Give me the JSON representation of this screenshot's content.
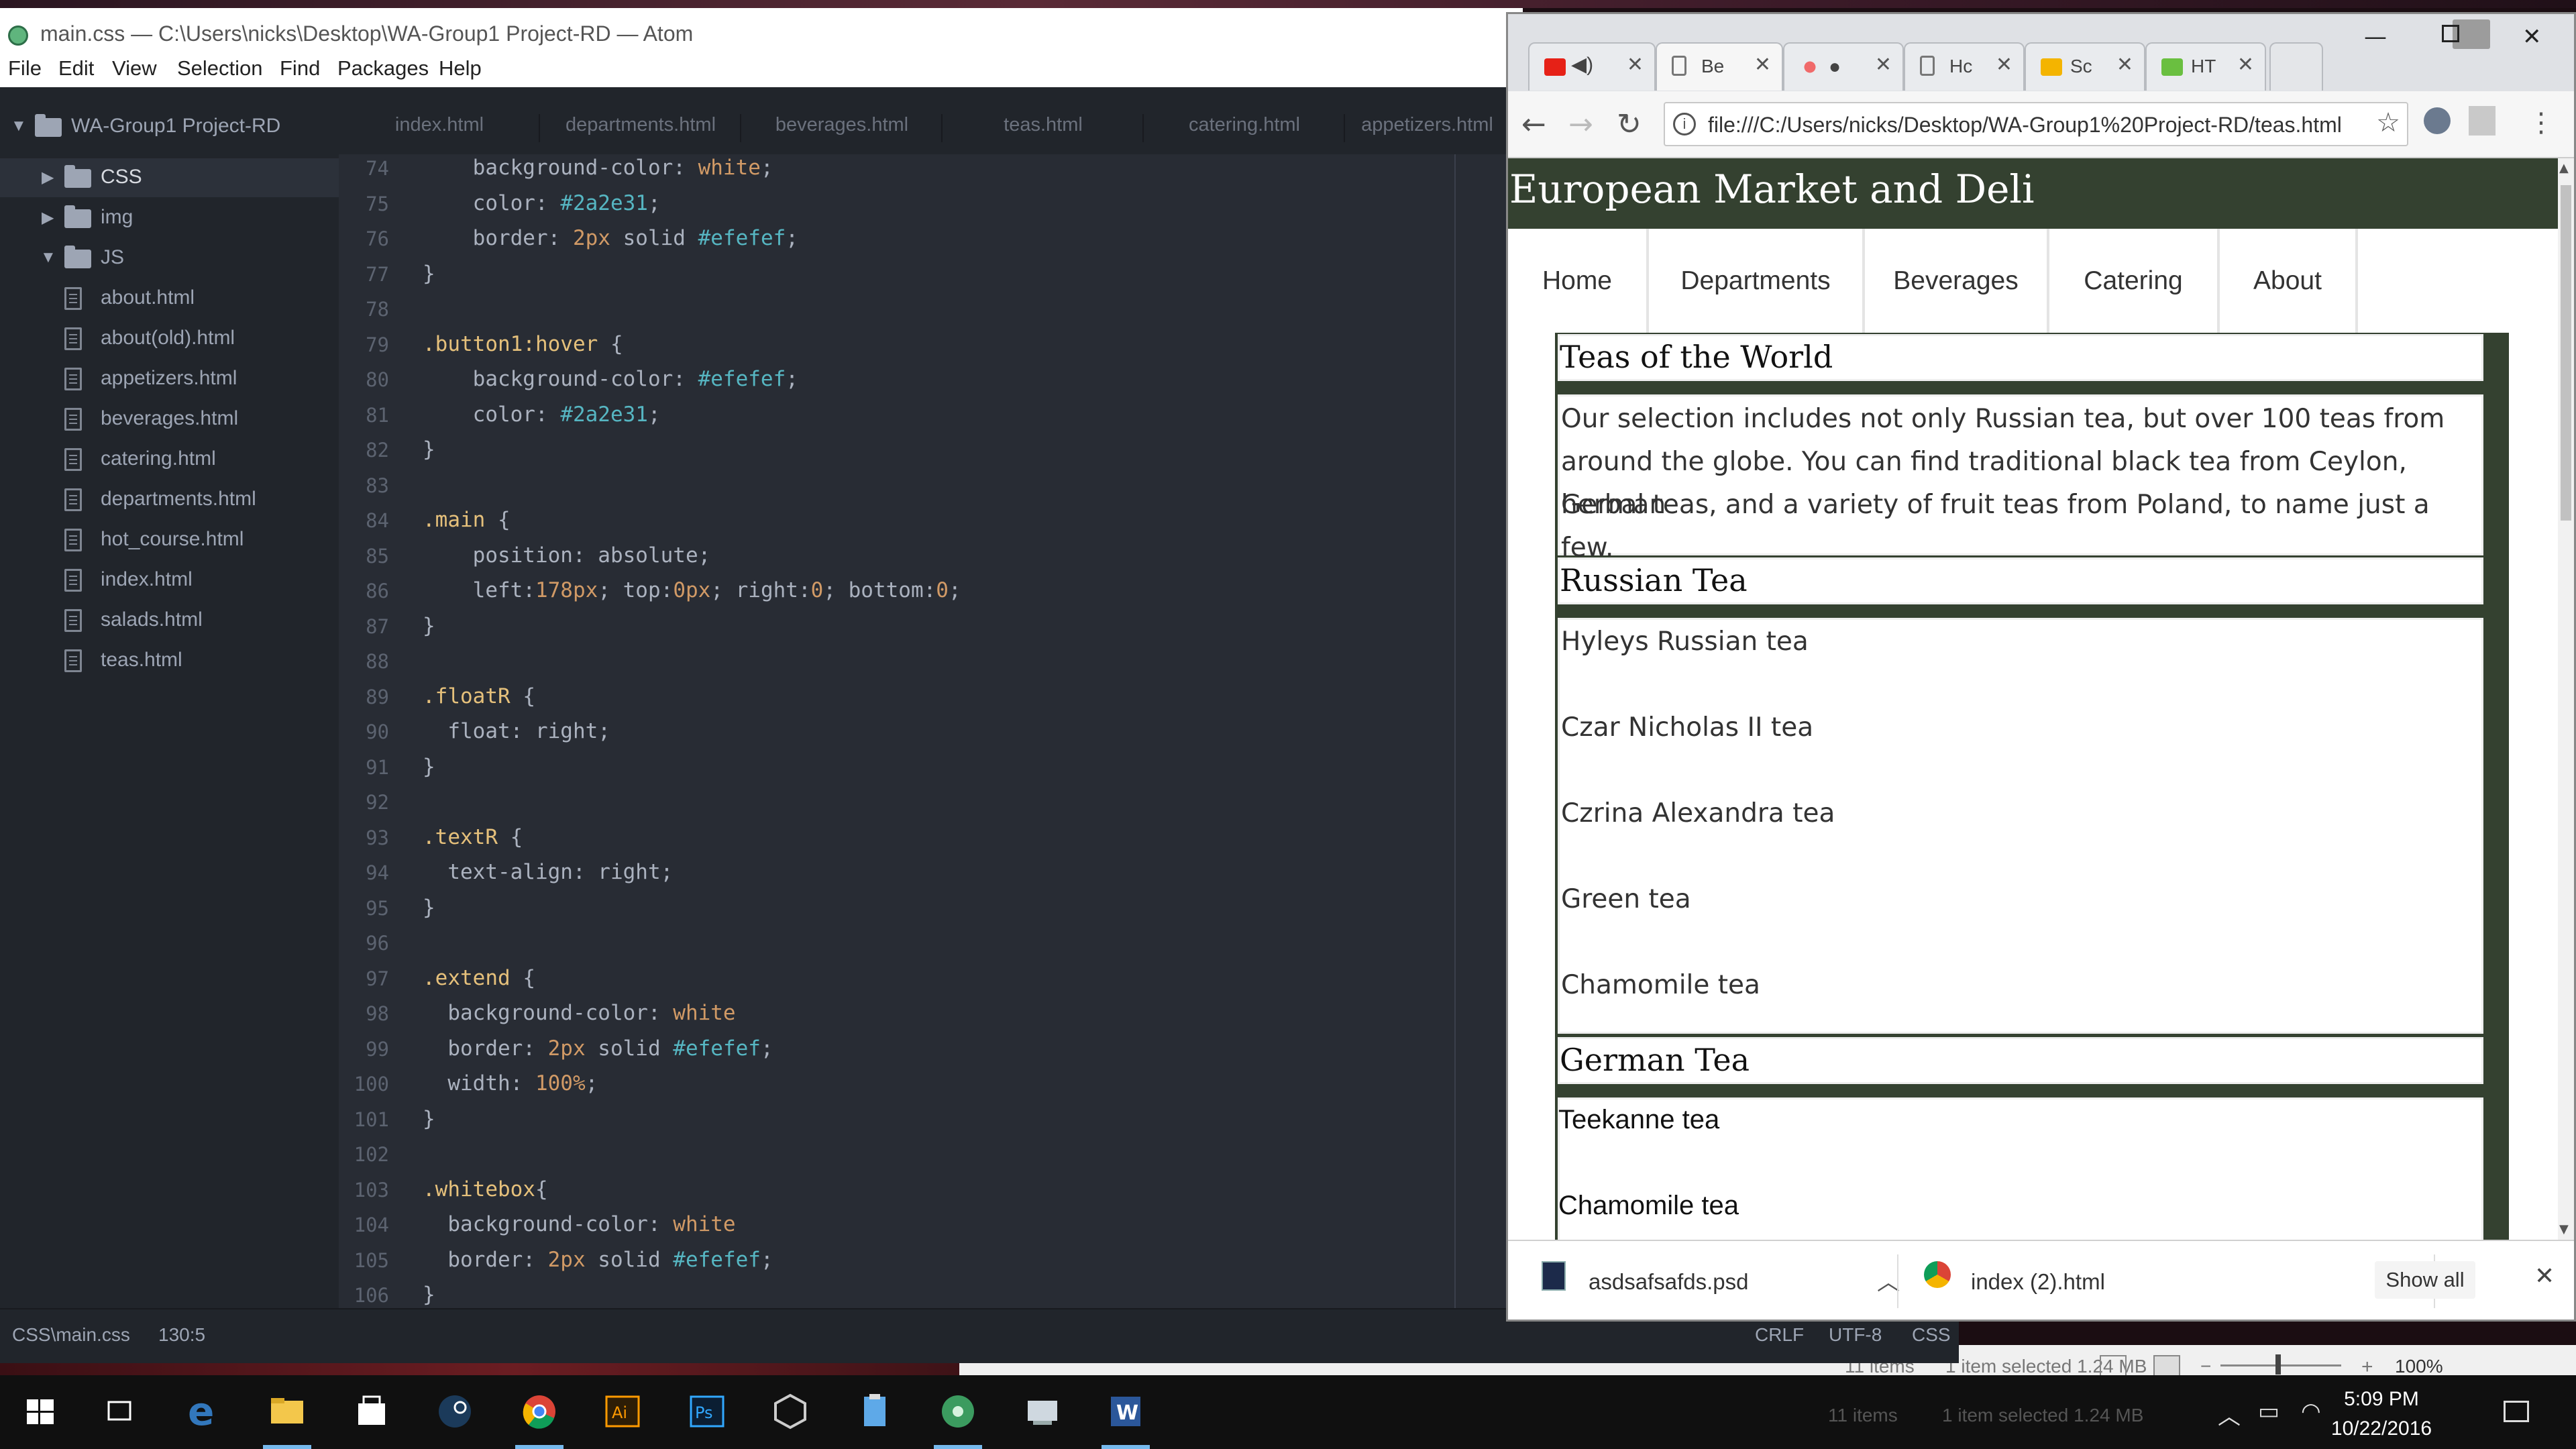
{
  "atom": {
    "title": "main.css — C:\\Users\\nicks\\Desktop\\WA-Group1 Project-RD — Atom",
    "menu": [
      "File",
      "Edit",
      "View",
      "Selection",
      "Find",
      "Packages",
      "Help"
    ],
    "project": "WA-Group1 Project-RD",
    "tree": {
      "folders": [
        "CSS",
        "img",
        "JS"
      ],
      "files": [
        "about.html",
        "about(old).html",
        "appetizers.html",
        "beverages.html",
        "catering.html",
        "departments.html",
        "hot_course.html",
        "index.html",
        "salads.html",
        "teas.html"
      ]
    },
    "tabs": [
      "index.html",
      "departments.html",
      "beverages.html",
      "teas.html",
      "catering.html",
      "appetizers.html"
    ],
    "line_numbers": [
      "74",
      "75",
      "76",
      "77",
      "78",
      "79",
      "80",
      "81",
      "82",
      "83",
      "84",
      "85",
      "86",
      "87",
      "88",
      "89",
      "90",
      "91",
      "92",
      "93",
      "94",
      "95",
      "96",
      "97",
      "98",
      "99",
      "100",
      "101",
      "102",
      "103",
      "104",
      "105",
      "106"
    ],
    "status": {
      "file": "CSS\\main.css",
      "cursor": "130:5",
      "line_ending": "CRLF",
      "encoding": "UTF-8",
      "grammar": "CSS"
    }
  },
  "chrome": {
    "tabs": [
      "",
      "Be",
      "",
      "Hc",
      "Sc",
      "HT"
    ],
    "url": "file:///C:/Users/nicks/Desktop/WA-Group1%20Project-RD/teas.html",
    "site": {
      "title": "European Market and Deli",
      "nav": [
        "Home",
        "Departments",
        "Beverages",
        "Catering",
        "About"
      ],
      "sections": [
        {
          "heading": "Teas of the World",
          "text_lines": [
            "Our selection includes not only Russian tea, but over 100 teas from",
            "around the globe. You can find traditional black tea from Ceylon, German",
            "herbal teas, and a variety of fruit teas from Poland, to name just a few."
          ]
        },
        {
          "heading": "Russian Tea",
          "items": [
            "Hyleys Russian tea",
            "Czar Nicholas II tea",
            "Czrina Alexandra tea",
            "Green tea",
            "Chamomile tea"
          ]
        },
        {
          "heading": "German Tea",
          "items": [
            "Teekanne tea",
            "Chamomile tea"
          ]
        }
      ]
    },
    "downloads": [
      "asdsafsafds.psd",
      "index (2).html"
    ],
    "show_all": "Show all"
  },
  "explorer": {
    "items": "11 items",
    "selected": "1 item selected  1.24 MB",
    "zoom": "100%"
  },
  "taskbar": {
    "time": "5:09 PM",
    "date": "10/22/2016"
  }
}
